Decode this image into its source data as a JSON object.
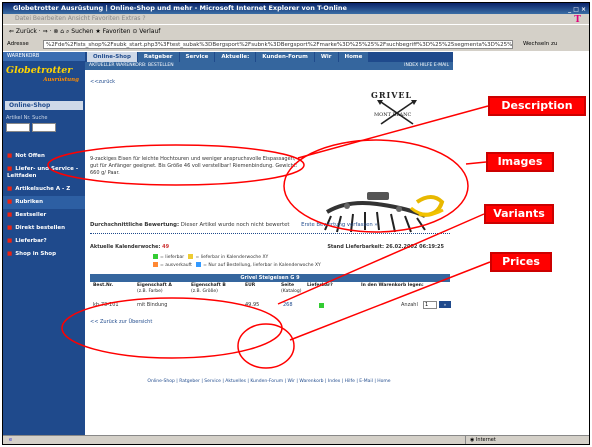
{
  "browser": {
    "title": "Globetrotter Ausrüstung | Online-Shop und mehr - Microsoft Internet Explorer von T-Online",
    "window_controls": "_ □ ×",
    "menu": "Datei  Bearbeiten  Ansicht  Favoriten  Extras  ?",
    "toolbar": "⇐ Zurück  ·  ⇒  ·  ⊗  ⌂  ⌕  Suchen  ★ Favoriten  ⊙ Verlauf",
    "address_label": "Adresse",
    "address_url": "%2Fde%2Fists_shop%2Fsubk_start.php3%3Ftest_subak%3DBergsport%2Fsubnk%3DBergsport%2Fmarke%3D%25%25%2Fsuchbegriff%3D%25%25segmenta%3D%25%25%2Fsubak%3D",
    "go_label": "Wechseln zu",
    "status_text": "",
    "zone": "Internet",
    "brand_logo": "T"
  },
  "sidebar": {
    "wk_label": "WARENKORB",
    "logo_line1": "Globetrotter",
    "logo_line2": "Ausrüstung",
    "shop_label": "Online-Shop",
    "search_label": "Artikel Nr.  Suche",
    "items": [
      {
        "label": "Not Offen"
      },
      {
        "label": "Liefer- und Service - Leitfaden"
      },
      {
        "label": "Artikelsuche A - Z"
      },
      {
        "label": "Rubriken"
      },
      {
        "label": "Bestseller"
      },
      {
        "label": "Direkt bestellen"
      },
      {
        "label": "Lieferbar?"
      },
      {
        "label": "Shop in Shop"
      }
    ]
  },
  "topnav": {
    "tabs": [
      {
        "label": "Online-Shop"
      },
      {
        "label": "Ratgeber"
      },
      {
        "label": "Service"
      },
      {
        "label": "Aktuelle:"
      },
      {
        "label": "Kunden-Forum"
      },
      {
        "label": "Wir"
      },
      {
        "label": "Home"
      }
    ],
    "subnav_left": "AKTUELLER WARENKORB: BESTELLEN",
    "subnav_right": "INDEX  HILFE  E-MAIL"
  },
  "product": {
    "back_link": "<<zurück",
    "brand_name": "GRIVEL",
    "brand_sub": "MONT BLANC",
    "description": "9-zackiges Eisen für leichte Hochtouren und weniger anspruchsvolle Eispassagen; gut für Anfänger geeignet. Bis Größe 46 voll verstellbar! Riemenbindung. Gewicht: 660 g/ Paar.",
    "avg_rating_label": "Durchschnittliche Bewertung:",
    "avg_rating_value": "Dieser Artikel wurde noch nicht bewertet",
    "review_link": "Erste Bewertung verfassen »",
    "kalender_label": "Aktuelle Kalenderwoche:",
    "kalender_week": "49",
    "stand_label": "Stand Lieferbarkeit:",
    "stand_value": "26.02.2002 06:19:25",
    "legend": [
      {
        "color": "green",
        "text": "= lieferbar"
      },
      {
        "color": "yellow",
        "text": "= lieferbar in Kalenderwoche XY"
      },
      {
        "color": "orange",
        "text": "= ausverkauft"
      },
      {
        "color": "blue",
        "text": "= Nur auf Bestellung, lieferbar in Kalenderwoche XY"
      }
    ],
    "table_title": "Grivel Steigeisen G 9",
    "columns": [
      {
        "label": "Best.Nr.",
        "sub": ""
      },
      {
        "label": "Eigenschaft A",
        "sub": "(z.B. Farbe)"
      },
      {
        "label": "Eigenschaft B",
        "sub": "(z.B. Größe)"
      },
      {
        "label": "EUR",
        "sub": ""
      },
      {
        "label": "Seite",
        "sub": "(Katalog)"
      },
      {
        "label": "Lieferbar?",
        "sub": ""
      },
      {
        "label": "In den Warenkorb legen:",
        "sub": ""
      }
    ],
    "row": {
      "best_nr": "kb-73-101",
      "eig_a": "mit Bindung",
      "eig_b": "",
      "eur": "49.95",
      "seite": "268",
      "anzahl_label": "Anzahl",
      "anzahl_value": "1",
      "cart_btn": "»"
    },
    "zurueck_link": "<< Zurück zur Übersicht",
    "footer_links": "Online-Shop | Ratgeber | Service | Aktuelles | Kunden-Forum | Wir | Warenkorb | Index | Hilfe | E-Mail | Home"
  },
  "annotations": [
    {
      "label": "Description"
    },
    {
      "label": "Images"
    },
    {
      "label": "Variants"
    },
    {
      "label": "Prices"
    }
  ],
  "colors": {
    "accent_navy": "#1f4a8c",
    "callout_red": "#ff0000",
    "brand_magenta": "#e2007a"
  }
}
